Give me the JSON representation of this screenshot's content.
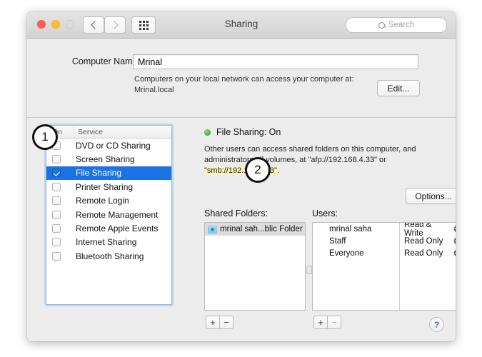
{
  "window": {
    "title": "Sharing",
    "traffic_lights": [
      "close",
      "minimize",
      "zoom"
    ],
    "nav": {
      "back": "‹",
      "forward": "›"
    },
    "grid_icon": "grid-icon",
    "search": {
      "placeholder": "Search",
      "icon": "search-icon"
    }
  },
  "computer_name": {
    "label": "Computer Name:",
    "value": "Mrinal",
    "description": "Computers on your local network can access your computer at:",
    "hostname": "Mrinal.local",
    "edit_button": "Edit..."
  },
  "services": {
    "columns": {
      "on": "On",
      "service": "Service"
    },
    "items": [
      {
        "name": "DVD or CD Sharing",
        "checked": false,
        "selected": false
      },
      {
        "name": "Screen Sharing",
        "checked": false,
        "selected": false
      },
      {
        "name": "File Sharing",
        "checked": true,
        "selected": true
      },
      {
        "name": "Printer Sharing",
        "checked": false,
        "selected": false
      },
      {
        "name": "Remote Login",
        "checked": false,
        "selected": false
      },
      {
        "name": "Remote Management",
        "checked": false,
        "selected": false
      },
      {
        "name": "Remote Apple Events",
        "checked": false,
        "selected": false
      },
      {
        "name": "Internet Sharing",
        "checked": false,
        "selected": false
      },
      {
        "name": "Bluetooth Sharing",
        "checked": false,
        "selected": false
      }
    ]
  },
  "detail": {
    "status_text": "File Sharing: On",
    "status_color": "#3cba35",
    "description_part1": "Other users can access shared folders on this computer, and administrators all volumes, at \"afp://192.168.4.33\" or ",
    "description_highlight": "\"smb://192.168.4.33\".",
    "highlight_color": "#fcf3c0",
    "options_button": "Options..."
  },
  "shared_folders": {
    "label": "Shared Folders:",
    "items": [
      {
        "name": "mrinal sah...blic Folder",
        "icon": "folder-icon",
        "selected": true
      }
    ],
    "add_button": "+",
    "remove_button": "−"
  },
  "users": {
    "label": "Users:",
    "items": [
      {
        "name": "mrinal saha",
        "icon": "single-user-icon",
        "permission": "Read & Write"
      },
      {
        "name": "Staff",
        "icon": "group-users-icon",
        "permission": "Read Only"
      },
      {
        "name": "Everyone",
        "icon": "everyone-users-icon",
        "permission": "Read Only"
      }
    ],
    "add_button": "+",
    "remove_button": "−"
  },
  "help_button": "?",
  "annotations": [
    {
      "number": "1"
    },
    {
      "number": "2"
    }
  ],
  "accent_color": "#1d72e3"
}
